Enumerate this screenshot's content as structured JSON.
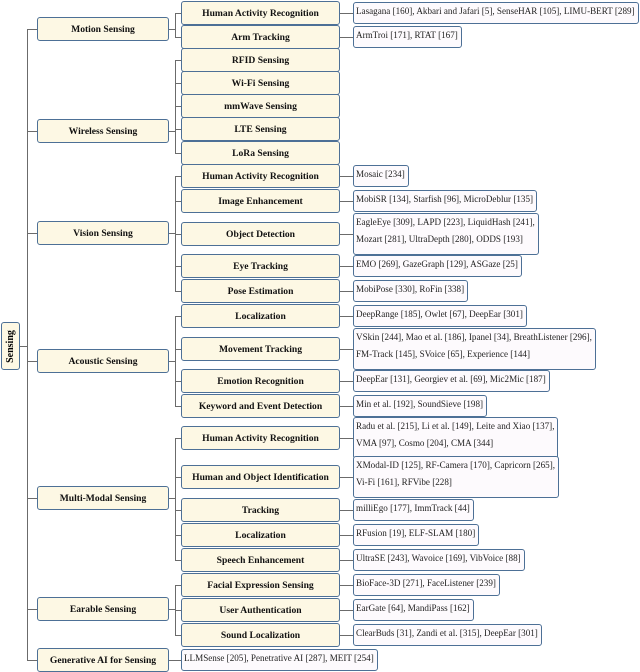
{
  "root": "Sensing",
  "categories": [
    {
      "label": "Motion Sensing",
      "children": [
        {
          "label": "Human Activity Recognition",
          "refs": [
            "Lasagana [160], Akbari and Jafari [5], SenseHAR [105], LIMU-BERT [289]"
          ]
        },
        {
          "label": "Arm Tracking",
          "refs": [
            "ArmTroi [171], RTAT [167]"
          ]
        }
      ]
    },
    {
      "label": "Wireless Sensing",
      "children": [
        {
          "label": "RFID Sensing"
        },
        {
          "label": "Wi-Fi Sensing"
        },
        {
          "label": "mmWave Sensing"
        },
        {
          "label": "LTE Sensing"
        },
        {
          "label": "LoRa Sensing"
        }
      ]
    },
    {
      "label": "Vision Sensing",
      "children": [
        {
          "label": "Human Activity Recognition",
          "refs": [
            "Mosaic [234]"
          ]
        },
        {
          "label": "Image Enhancement",
          "refs": [
            "MobiSR [134], Starfish [96], MicroDeblur [135]"
          ]
        },
        {
          "label": "Object Detection",
          "refs": [
            "EagleEye [309], LAPD [223], LiquidHash [241],",
            "Mozart [281], UltraDepth [280], ODDS [193]"
          ]
        },
        {
          "label": "Eye Tracking",
          "refs": [
            "EMO [269], GazeGraph [129], ASGaze [25]"
          ]
        },
        {
          "label": "Pose Estimation",
          "refs": [
            "MobiPose [330], RoFin [338]"
          ]
        }
      ]
    },
    {
      "label": "Acoustic Sensing",
      "children": [
        {
          "label": "Localization",
          "refs": [
            "DeepRange [185], Owlet [67], DeepEar [301]"
          ]
        },
        {
          "label": "Movement Tracking",
          "refs": [
            "VSkin [244], Mao et al. [186], Ipanel [34], BreathListener [296],",
            "FM-Track [145], SVoice [65], Experience [144]"
          ]
        },
        {
          "label": "Emotion Recognition",
          "refs": [
            "DeepEar [131], Georgiev et al. [69], Mic2Mic [187]"
          ]
        },
        {
          "label": "Keyword and Event Detection",
          "refs": [
            "Min et al. [192], SoundSieve [198]"
          ]
        }
      ]
    },
    {
      "label": "Multi-Modal Sensing",
      "children": [
        {
          "label": "Human Activity Recognition",
          "refs": [
            "Radu et al. [215], Li et al. [149], Leite and Xiao [137],",
            "VMA [97], Cosmo [204], CMA [344]"
          ]
        },
        {
          "label": "Human and Object Identification",
          "refs": [
            "XModal-ID [125], RF-Camera [170], Capricorn [265],",
            "Vi-Fi [161], RFVibe [228]"
          ]
        },
        {
          "label": "Tracking",
          "refs": [
            "milliEgo [177], ImmTrack [44]"
          ]
        },
        {
          "label": "Localization",
          "refs": [
            "RFusion [19], ELF-SLAM [180]"
          ]
        },
        {
          "label": "Speech Enhancement",
          "refs": [
            "UltraSE [243], Wavoice [169], VibVoice [88]"
          ]
        }
      ]
    },
    {
      "label": "Earable Sensing",
      "children": [
        {
          "label": "Facial Expression Sensing",
          "refs": [
            "BioFace-3D [271], FaceListener [239]"
          ]
        },
        {
          "label": "User Authentication",
          "refs": [
            "EarGate [64], MandiPass [162]"
          ]
        },
        {
          "label": "Sound Localization",
          "refs": [
            "ClearBuds [31], Zandi et al. [315], DeepEar [301]"
          ]
        }
      ]
    },
    {
      "label": "Generative AI for Sensing",
      "refs": [
        "LLMSense [205], Penetrative AI [287], MEIT [254]"
      ]
    }
  ],
  "colors": {
    "node_fill": "#fdf8e4",
    "leaf_fill": "#fdfafd",
    "border": "#4d7096",
    "connector": "#6b6b6b"
  }
}
